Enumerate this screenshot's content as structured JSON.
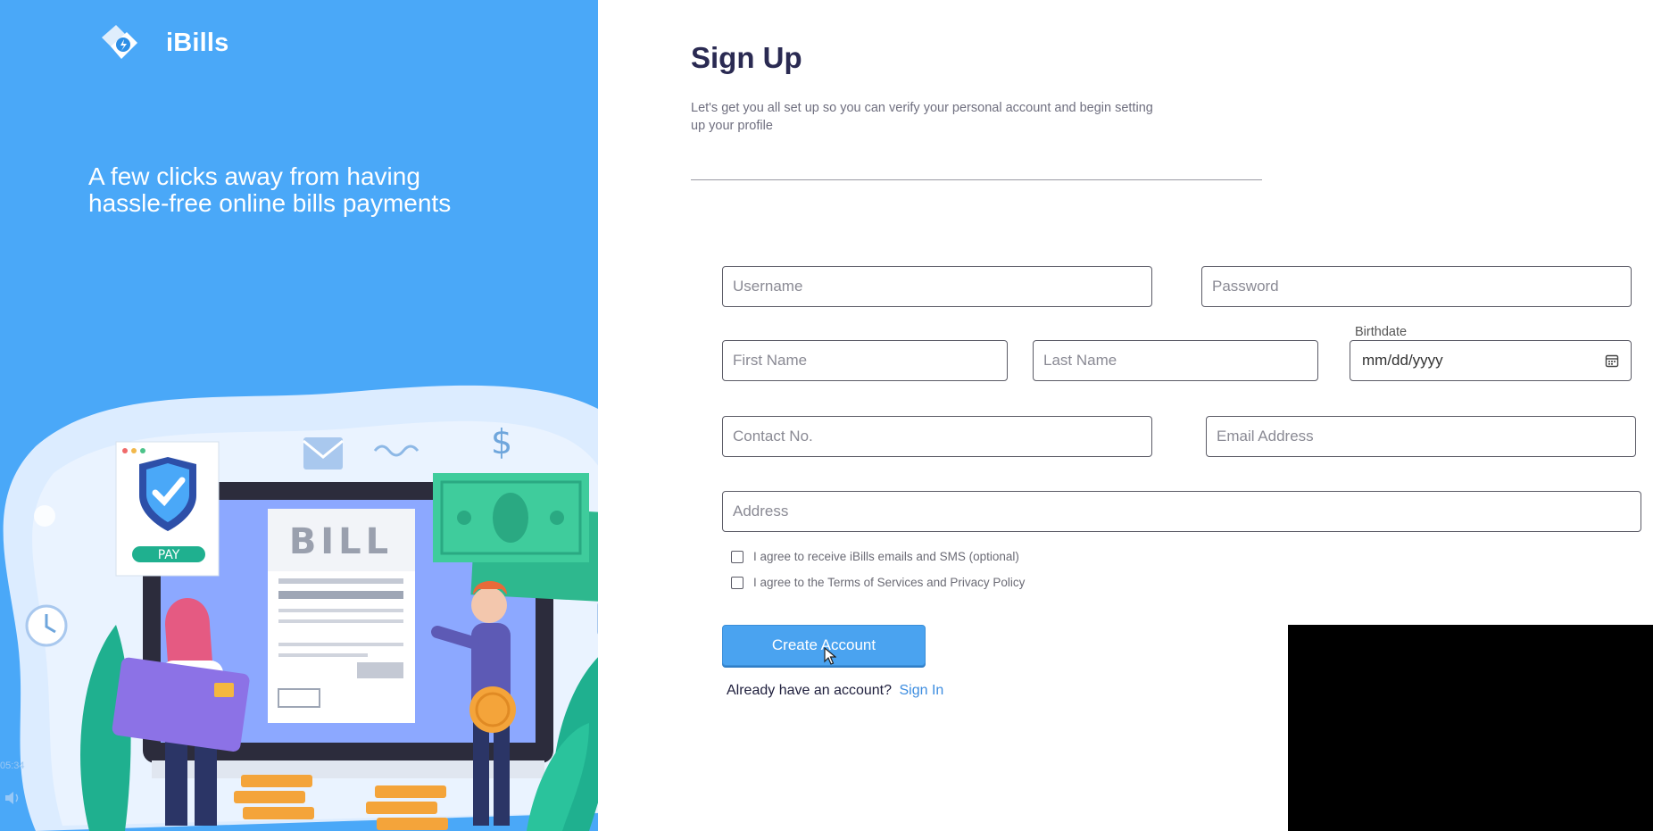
{
  "brand": {
    "name": "iBills"
  },
  "hero": {
    "tagline": "A few clicks away from having hassle-free online bills payments"
  },
  "illustration": {
    "bill_label": "BILL",
    "pay_label": "PAY"
  },
  "form": {
    "title": "Sign Up",
    "subtitle": "Let's get you all set up so you can verify your personal account and begin setting up your profile",
    "username_placeholder": "Username",
    "password_placeholder": "Password",
    "first_name_placeholder": "First Name",
    "last_name_placeholder": "Last Name",
    "birthdate_label": "Birthdate",
    "birthdate_placeholder": "mm/dd/yyyy",
    "contact_placeholder": "Contact No.",
    "email_placeholder": "Email Address",
    "address_placeholder": "Address",
    "checkbox_marketing": "I agree to receive iBills emails and SMS (optional)",
    "checkbox_terms": "I agree to the Terms of Services and Privacy Policy",
    "submit_label": "Create Account",
    "signin_prompt": "Already have an account?",
    "signin_link": "Sign In"
  },
  "video": {
    "timestamp": "05:34"
  },
  "colors": {
    "accent": "#4aa8f8",
    "button": "#4aa3f0",
    "link": "#3d8de0",
    "title": "#2a2a52"
  }
}
